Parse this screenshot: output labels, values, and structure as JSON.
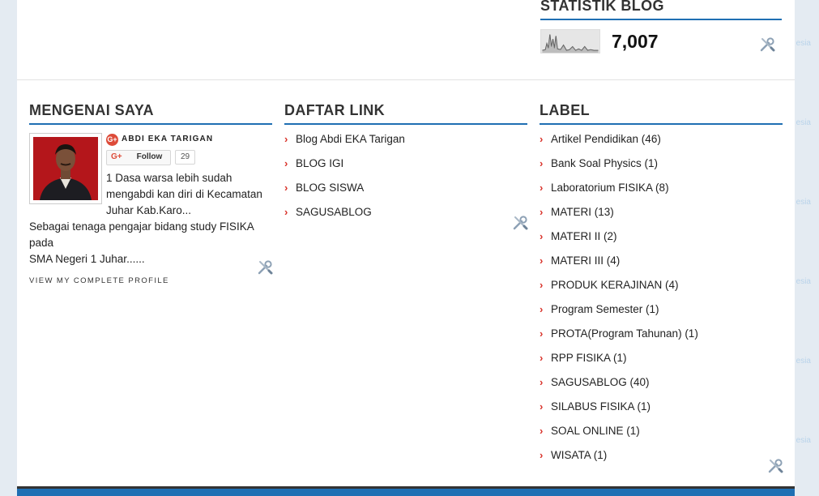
{
  "stats": {
    "title": "STATISTIK BLOG",
    "count": "7,007"
  },
  "about": {
    "title": "MENGENAI SAYA",
    "gplus_glyph": "G+",
    "name": "ABDI EKA TARIGAN",
    "follow_glyph": "G+",
    "follow_label": "Follow",
    "follower_count": "29",
    "bio_line1": "1 Dasa warsa lebih sudah",
    "bio_line2": "mengabdi kan diri di Kecamatan",
    "bio_line3": "Juhar Kab.Karo...",
    "bio_line4": "Sebagai tenaga pengajar bidang study FISIKA pada",
    "bio_line5": "SMA Negeri 1 Juhar......",
    "profile_link": "VIEW MY COMPLETE PROFILE"
  },
  "links": {
    "title": "DAFTAR LINK",
    "items": [
      "Blog Abdi EKA Tarigan",
      "BLOG IGI",
      "BLOG SISWA",
      "SAGUSABLOG"
    ]
  },
  "labels": {
    "title": "LABEL",
    "items": [
      "Artikel Pendidikan (46)",
      "Bank Soal Physics (1)",
      "Laboratorium FISIKA (8)",
      "MATERI (13)",
      "MATERI II (2)",
      "MATERI III (4)",
      "PRODUK KERAJINAN (4)",
      "Program Semester (1)",
      "PROTA(Program Tahunan) (1)",
      "RPP FISIKA (1)",
      "SAGUSABLOG (40)",
      "SILABUS FISIKA (1)",
      "SOAL ONLINE (1)",
      "WISATA (1)"
    ]
  },
  "background": {
    "watermark": "esia"
  },
  "icons": {
    "edit": "wrench-screwdriver-icon",
    "bullet": "chevron-right-icon"
  },
  "colors": {
    "accent": "#1f6fb3",
    "bullet": "#d9332b",
    "gplus": "#dd4b39",
    "page_bg": "#e4ebf2"
  }
}
